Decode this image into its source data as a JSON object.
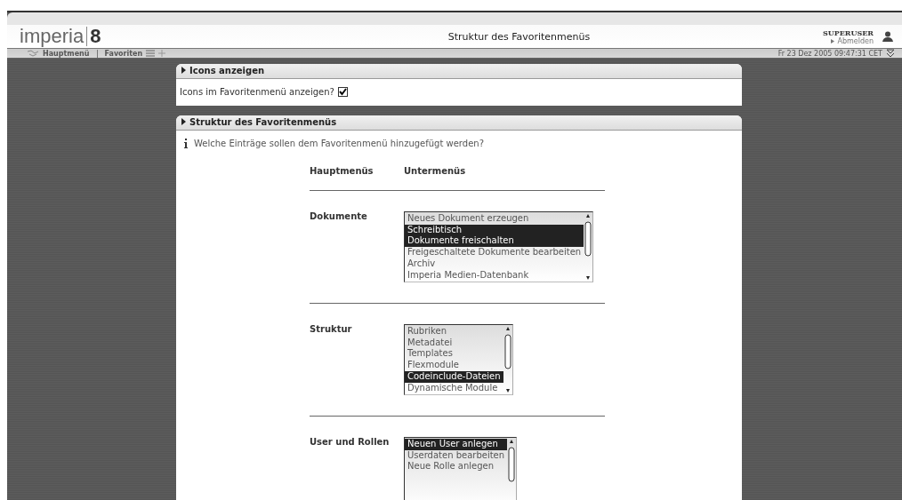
{
  "header": {
    "logo": {
      "name": "imperia",
      "version": "8"
    },
    "title": "Struktur des Favoritenmenüs",
    "user": {
      "name": "SUPERUSER",
      "logout": "Abmelden"
    }
  },
  "nav": {
    "items": [
      {
        "label": "Hauptmenü",
        "kind": "home"
      },
      {
        "label": "Favoriten",
        "kind": "favorites"
      }
    ],
    "datetime": "Fr 23 Dez 2005 09:47:31 CET"
  },
  "icons_panel": {
    "title": "Icons anzeigen",
    "question": "Icons im Favoritenmenü anzeigen?",
    "checked": true
  },
  "structure_panel": {
    "title": "Struktur des Favoritenmenüs",
    "info": "Welche Einträge sollen dem Favoritenmenü hinzugefügt werden?",
    "column_headers": [
      "Hauptmenüs",
      "Untermenüs"
    ],
    "groups": [
      {
        "label": "Dokumente",
        "items": [
          {
            "label": "Neues Dokument erzeugen",
            "selected": false
          },
          {
            "label": "Schreibtisch",
            "selected": true
          },
          {
            "label": "Dokumente freischalten",
            "selected": true
          },
          {
            "label": "Freigeschaltete Dokumente bearbeiten",
            "selected": false
          },
          {
            "label": "Archiv",
            "selected": false
          },
          {
            "label": "Imperia Medien-Datenbank",
            "selected": false
          }
        ]
      },
      {
        "label": "Struktur",
        "items": [
          {
            "label": "Rubriken",
            "selected": false
          },
          {
            "label": "Metadatei",
            "selected": false
          },
          {
            "label": "Templates",
            "selected": false
          },
          {
            "label": "Flexmodule",
            "selected": false
          },
          {
            "label": "Codeinclude-Dateien",
            "selected": true
          },
          {
            "label": "Dynamische Module",
            "selected": false
          }
        ]
      },
      {
        "label": "User und Rollen",
        "items": [
          {
            "label": "Neuen User anlegen",
            "selected": true
          },
          {
            "label": "Userdaten bearbeiten",
            "selected": false
          },
          {
            "label": "Neue Rolle anlegen",
            "selected": false
          }
        ]
      }
    ]
  }
}
